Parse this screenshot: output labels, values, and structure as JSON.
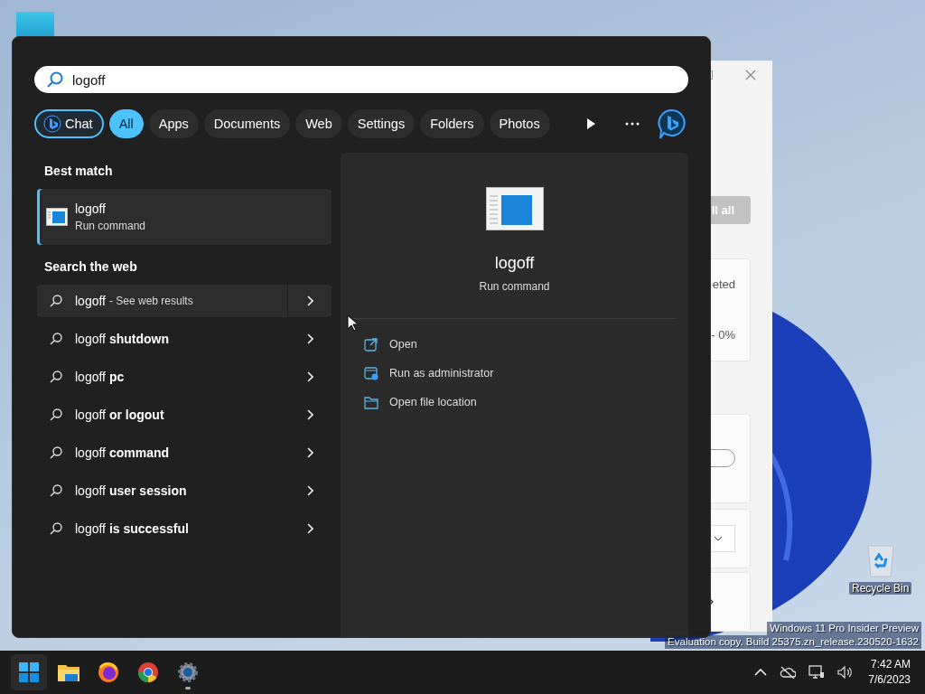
{
  "background_window": {
    "button_text": "ll all",
    "card_text_1": "eted",
    "card_text_2": "- 0%",
    "toggle": {
      "on": false
    }
  },
  "desktop": {
    "icons": [
      {
        "label": "Recycle Bin"
      }
    ],
    "watermark": [
      "Windows 11 Pro Insider Preview",
      "Evaluation copy. Build 25375.zn_release.230520-1632"
    ]
  },
  "start_menu": {
    "search": {
      "value": "logoff"
    },
    "filters": [
      {
        "label": "Chat",
        "kind": "chat",
        "selected": false
      },
      {
        "label": "All",
        "kind": "chip",
        "selected": true
      },
      {
        "label": "Apps",
        "kind": "chip",
        "selected": false
      },
      {
        "label": "Documents",
        "kind": "chip",
        "selected": false
      },
      {
        "label": "Web",
        "kind": "chip",
        "selected": false
      },
      {
        "label": "Settings",
        "kind": "chip",
        "selected": false
      },
      {
        "label": "Folders",
        "kind": "chip",
        "selected": false
      },
      {
        "label": "Photos",
        "kind": "chip",
        "selected": false
      }
    ],
    "best_match": {
      "heading": "Best match",
      "name": "logoff",
      "type": "Run command",
      "selected": true
    },
    "web": {
      "heading": "Search the web",
      "items": [
        {
          "text": "logoff",
          "hint": "- See web results",
          "selected": true
        },
        {
          "text": "logoff **shutdown**",
          "selected": false
        },
        {
          "text": "logoff **pc**",
          "selected": false
        },
        {
          "text": "logoff **or logout**",
          "selected": false
        },
        {
          "text": "logoff **command**",
          "selected": false
        },
        {
          "text": "logoff **user session**",
          "selected": false
        },
        {
          "text": "logoff **is successful**",
          "selected": false
        }
      ]
    },
    "preview": {
      "name": "logoff",
      "type": "Run command",
      "actions": [
        {
          "label": "Open",
          "kind": "open"
        },
        {
          "label": "Run as administrator",
          "kind": "admin"
        },
        {
          "label": "Open file location",
          "kind": "folder"
        }
      ]
    }
  },
  "taskbar": {
    "apps": [
      {
        "kind": "start",
        "running": false
      },
      {
        "kind": "explorer",
        "running": false
      },
      {
        "kind": "firefox",
        "running": false
      },
      {
        "kind": "chrome",
        "running": false
      },
      {
        "kind": "settings",
        "running": true
      }
    ],
    "time": "7:42 AM",
    "date": "7/6/2023"
  }
}
